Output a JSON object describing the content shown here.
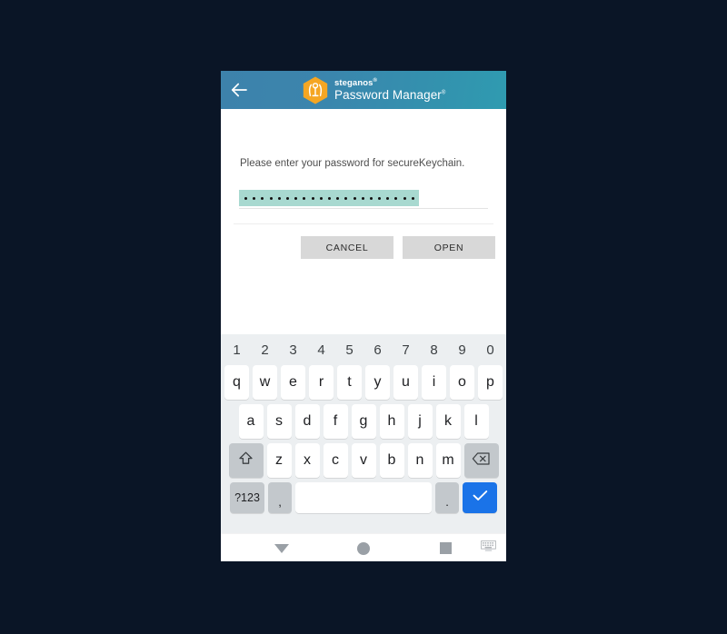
{
  "canvas": {
    "background_color": "#0a1526"
  },
  "app": {
    "header": {
      "back_icon": "arrow-left-icon",
      "logo_icon": "steganos-hexagon-logo-icon",
      "brand_name": "steganos",
      "brand_product": "Password Manager",
      "trademark_mark": "®",
      "gradient_from": "#3d82ab",
      "gradient_to": "#2f9bb0"
    },
    "dialog": {
      "prompt": "Please enter your password for secureKeychain.",
      "password_field": {
        "name": "password-input",
        "masked_char": "•",
        "masked_length": 26,
        "placeholder": "",
        "selection_color": "#a8d9d0",
        "selected": true
      },
      "buttons": [
        {
          "label": "CANCEL",
          "name": "cancel-button"
        },
        {
          "label": "OPEN",
          "name": "open-button"
        }
      ],
      "button_color": "#d8d8d8"
    }
  },
  "keyboard": {
    "background_color": "#eceff1",
    "number_row": [
      "1",
      "2",
      "3",
      "4",
      "5",
      "6",
      "7",
      "8",
      "9",
      "0"
    ],
    "row_top": [
      "q",
      "w",
      "e",
      "r",
      "t",
      "y",
      "u",
      "i",
      "o",
      "p"
    ],
    "row_home": [
      "a",
      "s",
      "d",
      "f",
      "g",
      "h",
      "j",
      "k",
      "l"
    ],
    "row_bottom": [
      "z",
      "x",
      "c",
      "v",
      "b",
      "n",
      "m"
    ],
    "shift_key": {
      "name": "shift-key",
      "icon": "shift-arrow-up-icon"
    },
    "backspace_key": {
      "name": "backspace-key",
      "icon": "backspace-delete-icon"
    },
    "symbols_key": {
      "label": "?123",
      "name": "symbols-key"
    },
    "comma_key": {
      "label": ",",
      "name": "comma-key"
    },
    "space_key": {
      "label": "",
      "name": "space-key"
    },
    "period_key": {
      "label": ".",
      "name": "period-key"
    },
    "enter_key": {
      "name": "enter-key",
      "icon": "checkmark-icon",
      "color": "#1a73e8"
    }
  },
  "nav_bar": {
    "back": {
      "name": "nav-back-button",
      "icon": "triangle-down-icon"
    },
    "home": {
      "name": "nav-home-button",
      "icon": "circle-icon"
    },
    "recents": {
      "name": "nav-recents-button",
      "icon": "square-icon"
    },
    "keyboard_switcher": {
      "name": "nav-keyboard-switcher-button",
      "icon": "keyboard-icon"
    },
    "icon_color": "#9aa0a6"
  }
}
